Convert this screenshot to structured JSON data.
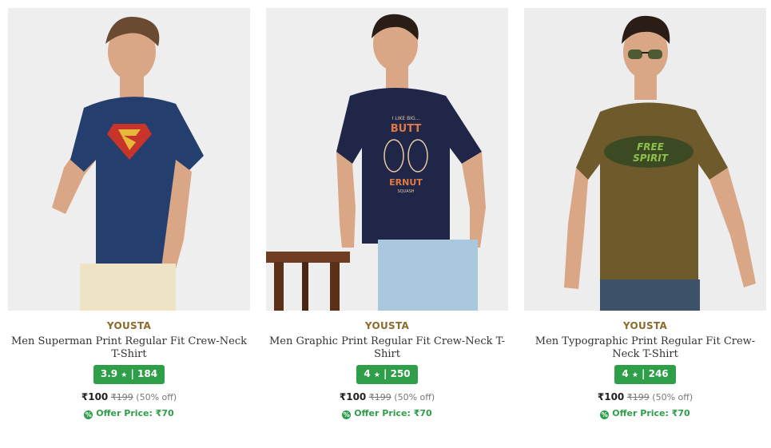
{
  "products": [
    {
      "brand": "YOUSTA",
      "title": "Men Superman Print Regular Fit Crew-Neck T-Shirt",
      "rating": "3.9",
      "reviews": "184",
      "price": "₹100",
      "mrp": "₹199",
      "discount": "(50% off)",
      "offer": "Offer Price: ₹70",
      "shirt_color": "#243f6e",
      "bg_color": "#eeeeee"
    },
    {
      "brand": "YOUSTA",
      "title": "Men Graphic Print Regular Fit Crew-Neck T-Shirt",
      "rating": "4",
      "reviews": "250",
      "price": "₹100",
      "mrp": "₹199",
      "discount": "(50% off)",
      "offer": "Offer Price: ₹70",
      "shirt_color": "#202647",
      "bg_color": "#eeeeee"
    },
    {
      "brand": "YOUSTA",
      "title": "Men Typographic Print Regular Fit Crew-Neck T-Shirt",
      "rating": "4",
      "reviews": "246",
      "price": "₹100",
      "mrp": "₹199",
      "discount": "(50% off)",
      "offer": "Offer Price: ₹70",
      "shirt_color": "#6f5a2c",
      "bg_color": "#ededed"
    }
  ],
  "graphics": {
    "print_1_top": "I LIKE BIG...",
    "print_1_mid": "BUTT",
    "print_1_bottom": "ERNUT",
    "print_1_sub": "SQUASH",
    "print_2_line1": "FREE",
    "print_2_line2": "SPIRIT"
  },
  "colors": {
    "brand": "#8b6a2b",
    "rating_bg": "#2e9e49",
    "offer": "#2e9e49"
  }
}
